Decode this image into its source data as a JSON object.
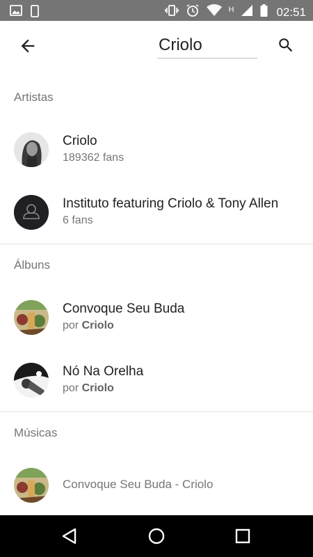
{
  "status_bar": {
    "time": "02:51",
    "network_label": "H",
    "icons": [
      "image-icon",
      "phone-icon",
      "vibrate-icon",
      "alarm-icon",
      "wifi-icon",
      "signal-icon",
      "battery-icon"
    ]
  },
  "app_bar": {
    "search_value": "Criolo",
    "back_icon": "arrow-back-icon",
    "search_icon": "search-icon"
  },
  "sections": {
    "artists": {
      "header": "Artistas",
      "items": [
        {
          "title": "Criolo",
          "subtitle": "189362 fans"
        },
        {
          "title": "Instituto featuring Criolo & Tony Allen",
          "subtitle": "6 fans"
        }
      ]
    },
    "albums": {
      "header": "Álbuns",
      "items": [
        {
          "title": "Convoque Seu Buda",
          "subtitle_prefix": "por",
          "subtitle_artist": "Criolo"
        },
        {
          "title": "Nó Na Orelha",
          "subtitle_prefix": "por",
          "subtitle_artist": "Criolo"
        }
      ]
    },
    "songs": {
      "header": "Músicas",
      "items": [
        {
          "title": "Convoque Seu Buda - Criolo"
        }
      ]
    }
  },
  "nav_bar": {
    "icons": [
      "back-triangle-icon",
      "home-circle-icon",
      "recents-square-icon"
    ]
  },
  "colors": {
    "status_bar": "#757575",
    "nav_bar": "#000000",
    "section_header": "#757575",
    "primary_text": "#212121",
    "secondary_text": "#757575"
  }
}
